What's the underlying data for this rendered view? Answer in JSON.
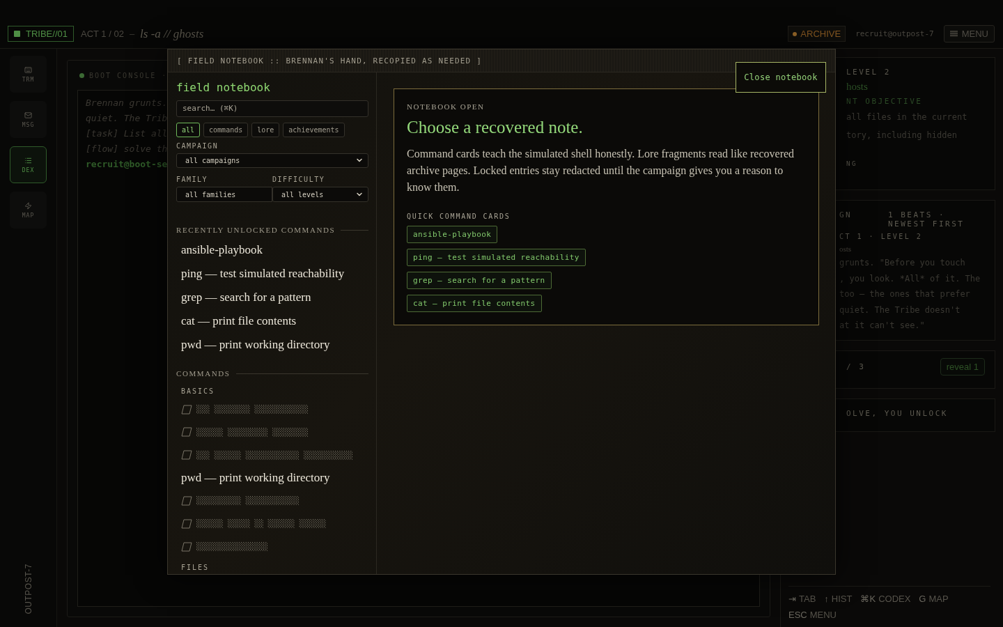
{
  "topbar": {
    "tribe": "TRIBE//01",
    "act": "ACT 1 / 02",
    "separator": "–",
    "title": "ls -a // ghosts",
    "archive": "ARCHIVE",
    "user": "recruit@outpost-7",
    "menu": "MENU"
  },
  "nav": [
    {
      "kind": "keyboard",
      "label": "TRM",
      "selected": false
    },
    {
      "kind": "mail",
      "label": "MSG",
      "selected": false
    },
    {
      "kind": "list",
      "label": "DEX",
      "selected": true
    },
    {
      "kind": "bolt",
      "label": "MAP",
      "selected": false
    }
  ],
  "outpost": "OUTPOST-7",
  "console": {
    "title": "BOOT CONSOLE ·",
    "lines": [
      {
        "kind": "narration",
        "text": "Brennan grunts."
      },
      {
        "kind": "narration",
        "text": "quiet. The Trib"
      },
      {
        "kind": "narration",
        "text": "[task] List all"
      },
      {
        "kind": "narration",
        "text": "[flow] solve th"
      },
      {
        "kind": "prompt",
        "text": "recruit@boot-se"
      }
    ]
  },
  "side": {
    "objective_card": {
      "level": "LEVEL 2",
      "title": "hosts",
      "label": "NT OBJECTIVE",
      "lines": [
        "all files in the current",
        "tory, including hidden"
      ],
      "footer": "NG"
    },
    "log_card": {
      "label": "GN",
      "meta": "1 BEATS · NEWEST FIRST",
      "sub": "CT 1 · LEVEL 2",
      "title": "osts",
      "lines": [
        "grunts. \"Before you touch",
        ", you look. *All* of it. The",
        "too — the ones that prefer",
        "quiet. The Tribe doesn't",
        "at it can't see.\""
      ]
    },
    "hint_card": {
      "count": "/ 3",
      "button": "reveal 1"
    },
    "unlock_card": {
      "label": "OLVE, YOU UNLOCK"
    },
    "shortcuts": [
      {
        "key": "⇥",
        "label": "TAB"
      },
      {
        "key": "↑",
        "label": "HIST"
      },
      {
        "key": "⌘K",
        "label": "CODEX"
      },
      {
        "key": "G",
        "label": "MAP"
      },
      {
        "key": "ESC",
        "label": "MENU"
      }
    ]
  },
  "notebook": {
    "header": "[ FIELD NOTEBOOK :: BRENNAN'S HAND, RECOPIED AS NEEDED ]",
    "close": "Close notebook",
    "title": "field notebook",
    "search": {
      "placeholder": "search… (⌘K)"
    },
    "filters": [
      {
        "label": "all",
        "selected": true
      },
      {
        "label": "commands",
        "selected": false
      },
      {
        "label": "lore",
        "selected": false
      },
      {
        "label": "achievements",
        "selected": false
      }
    ],
    "campaign": {
      "label": "CAMPAIGN",
      "value": "all campaigns"
    },
    "family": {
      "label": "FAMILY",
      "value": "all families"
    },
    "difficulty": {
      "label": "DIFFICULTY",
      "value": "all levels"
    },
    "recent": {
      "heading": "RECENTLY UNLOCKED COMMANDS",
      "items": [
        "ansible-playbook",
        "ping — test simulated reachability",
        "grep — search for a pattern",
        "cat — print file contents",
        "pwd — print working directory"
      ]
    },
    "commands": {
      "heading": "COMMANDS",
      "groups": [
        {
          "name": "BASICS",
          "entries": [
            {
              "kind": "locked",
              "text": "░░░ ░░░░░░░░ ░░░░░░░░░░░░"
            },
            {
              "kind": "locked",
              "text": "░░░░░░ ░░░░░░░░░ ░░░░░░░░"
            },
            {
              "kind": "locked",
              "text": "░░░ ░░░░░░ ░░░░░░░░░░░░ ░░░░░░░░░░░"
            },
            {
              "kind": "unlocked",
              "text": "pwd — print working directory"
            },
            {
              "kind": "locked",
              "text": "░░░░░░░░░░ ░░░░░░░░░░░░"
            },
            {
              "kind": "locked",
              "text": "░░░░░░ ░░░░░ ░░ ░░░░░░ ░░░░░░"
            },
            {
              "kind": "locked",
              "text": "░░░░░░░░░░░░░░░░"
            }
          ]
        },
        {
          "name": "FILES"
        }
      ]
    },
    "detail": {
      "eyebrow": "NOTEBOOK OPEN",
      "heading": "Choose a recovered note.",
      "body": "Command cards teach the simulated shell honestly. Lore fragments read like recovered archive pages. Locked entries stay redacted until the campaign gives you a reason to know them.",
      "quick_label": "QUICK COMMAND CARDS",
      "cards": [
        "ansible-playbook",
        "ping — test simulated reachability",
        "grep — search for a pattern",
        "cat — print file contents"
      ]
    }
  }
}
